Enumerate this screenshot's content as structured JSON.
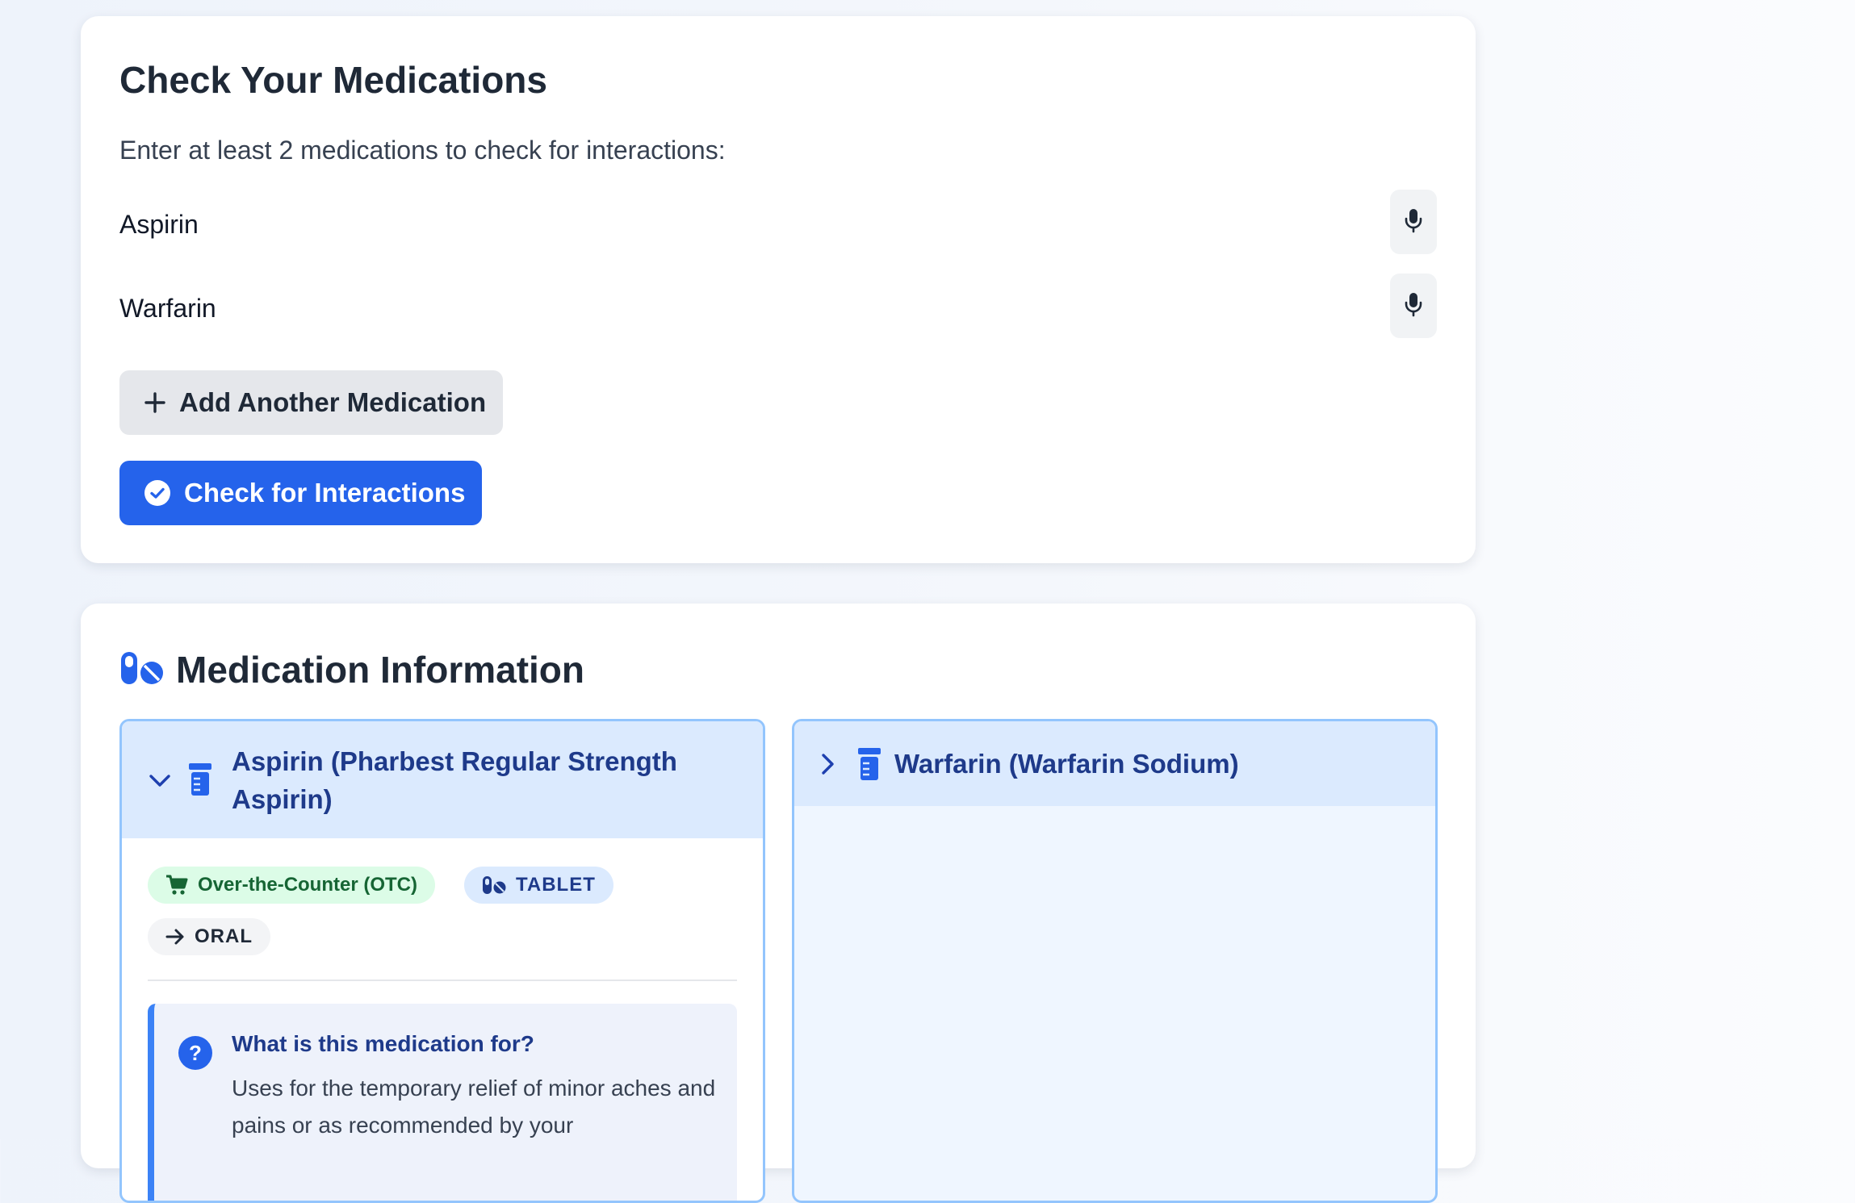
{
  "checker": {
    "title": "Check Your Medications",
    "intro": "Enter at least 2 medications to check for interactions:",
    "medications": [
      "Aspirin",
      "Warfarin"
    ],
    "add_label": "Add Another Medication",
    "check_label": "Check for Interactions"
  },
  "info": {
    "title": "Medication Information",
    "cards": [
      {
        "name": "Aspirin (Pharbest Regular Strength Aspirin)",
        "expanded": true,
        "badges": {
          "otc": "Over-the-Counter (OTC)",
          "form": "TABLET",
          "route": "ORAL"
        },
        "purpose_title": "What is this medication for?",
        "purpose_text": "Uses for the temporary relief of minor aches and pains or as recommended by your"
      },
      {
        "name": "Warfarin (Warfarin Sodium)",
        "expanded": false
      }
    ]
  },
  "colors": {
    "primary": "#2563eb",
    "header_bg": "#dbeafe",
    "otc_bg": "#dcfce7",
    "otc_text": "#166534"
  },
  "icons": [
    "mic-icon",
    "plus-icon",
    "check-circle-icon",
    "pills-icon",
    "chevron-down-icon",
    "chevron-right-icon",
    "pill-bottle-icon",
    "cart-icon",
    "arrow-right-icon",
    "question-icon"
  ]
}
